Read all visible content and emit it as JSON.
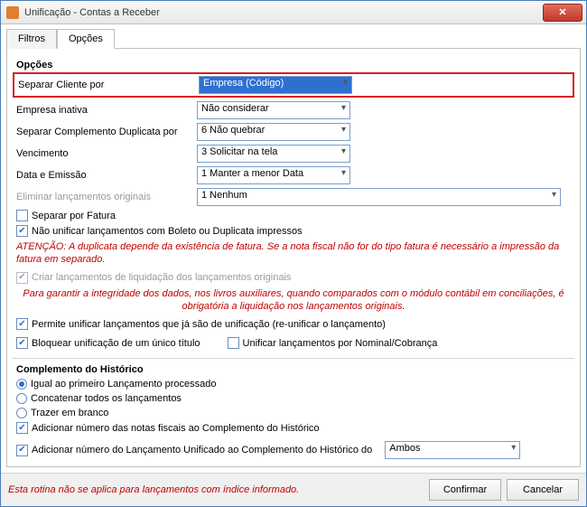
{
  "window": {
    "title": "Unificação - Contas a Receber"
  },
  "tabs": {
    "filtros": "Filtros",
    "opcoes": "Opções"
  },
  "group_opcoes_title": "Opções",
  "fields": {
    "separar_cliente": {
      "label": "Separar Cliente por",
      "value": "Empresa (Código)"
    },
    "empresa_inativa": {
      "label": "Empresa inativa",
      "value": "Não considerar"
    },
    "separar_complemento": {
      "label": "Separar Complemento Duplicata por",
      "value": "6 Não quebrar"
    },
    "vencimento": {
      "label": "Vencimento",
      "value": "3 Solicitar na tela"
    },
    "data_emissao": {
      "label": "Data e Emissão",
      "value": "1 Manter a menor Data"
    },
    "eliminar": {
      "label": "Eliminar lançamentos originais",
      "value": "1 Nenhum"
    }
  },
  "checks": {
    "separar_fatura": "Separar por Fatura",
    "nao_unificar_boleto": "Não unificar lançamentos com Boleto ou Duplicata impressos",
    "criar_liquidacao": "Criar lançamentos de liquidação dos lançamentos originais",
    "permite_reunificar": "Permite unificar lançamentos que já são de unificação (re-unificar o lançamento)",
    "bloquear_unico": "Bloquear unificação de um único título",
    "unificar_nominal": "Unificar lançamentos por Nominal/Cobrança"
  },
  "warns": {
    "atencao": "ATENÇÃO: A duplicata depende da existência de fatura. Se a nota fiscal não for do tipo fatura é necessário a impressão da fatura em separado.",
    "integridade": "Para garantir a integridade dos dados, nos livros auxiliares, quando comparados com o módulo contábil em conciliações, é obrigatória a liquidação nos lançamentos originais."
  },
  "complemento": {
    "title": "Complemento do Histórico",
    "igual_primeiro": "Igual ao primeiro Lançamento processado",
    "concatenar": "Concatenar todos os lançamentos",
    "trazer_branco": "Trazer em branco",
    "adicionar_nf": "Adicionar número das notas fiscais ao Complemento do Histórico",
    "adicionar_unificado": "Adicionar número do Lançamento Unificado ao Complemento do Histórico do",
    "ambos": "Ambos"
  },
  "footer": {
    "note": "Esta rotina não se aplica para lançamentos com índice informado.",
    "confirmar": "Confirmar",
    "cancelar": "Cancelar"
  }
}
